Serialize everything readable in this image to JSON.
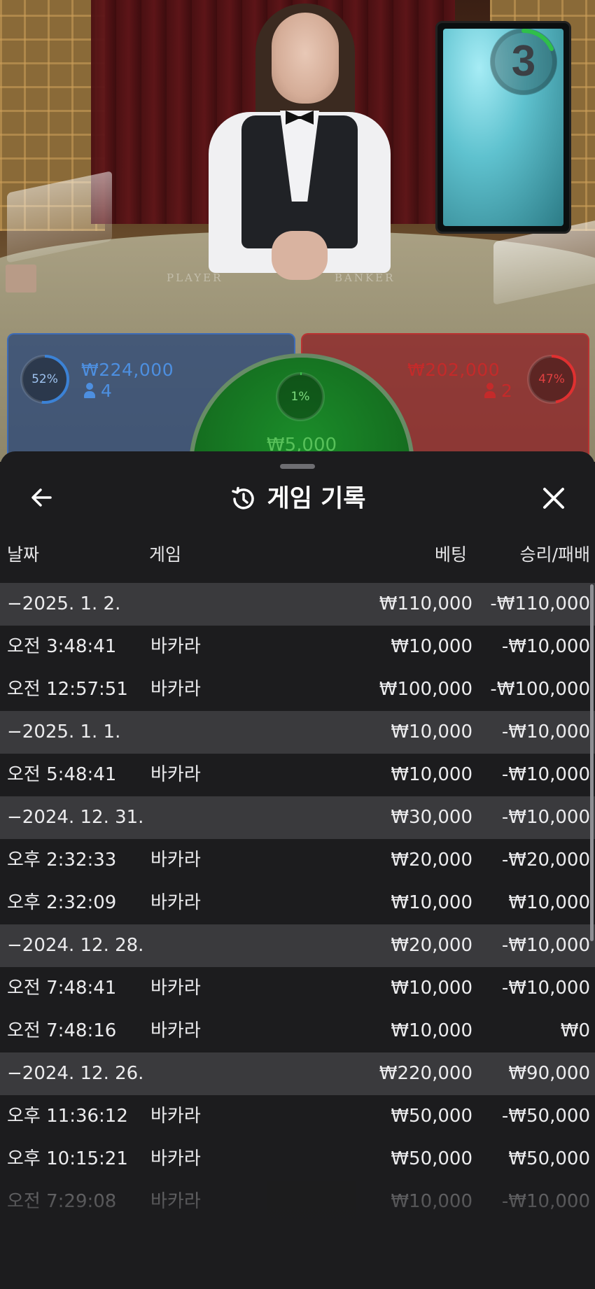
{
  "scene": {
    "table_labels": [
      "PLAYER",
      "BANKER"
    ],
    "countdown": "3"
  },
  "bets": {
    "player": {
      "percent_label": "52%",
      "percent": 52,
      "amount": "₩224,000",
      "players": "4",
      "color": "#3b82d6"
    },
    "banker": {
      "percent_label": "47%",
      "percent": 47,
      "amount": "₩202,000",
      "players": "2",
      "color": "#d63030"
    },
    "tie": {
      "percent_label": "1%",
      "percent": 1,
      "amount": "₩5,000",
      "color": "#3cc24a"
    }
  },
  "history": {
    "title": "게임 기록",
    "icons": {
      "back": "arrow-left-icon",
      "history": "history-clock-icon",
      "close": "close-icon"
    },
    "columns": {
      "date": "날짜",
      "game": "게임",
      "bet": "베팅",
      "result": "승리/패배"
    },
    "rows": [
      {
        "type": "group",
        "date": "−2025. 1. 2.",
        "game": "",
        "bet": "₩110,000",
        "result": "-₩110,000"
      },
      {
        "type": "item",
        "date": "오전 3:48:41",
        "game": "바카라",
        "bet": "₩10,000",
        "result": "-₩10,000"
      },
      {
        "type": "item",
        "date": "오전 12:57:51",
        "game": "바카라",
        "bet": "₩100,000",
        "result": "-₩100,000"
      },
      {
        "type": "group",
        "date": "−2025. 1. 1.",
        "game": "",
        "bet": "₩10,000",
        "result": "-₩10,000"
      },
      {
        "type": "item",
        "date": "오전 5:48:41",
        "game": "바카라",
        "bet": "₩10,000",
        "result": "-₩10,000"
      },
      {
        "type": "group",
        "date": "−2024. 12. 31.",
        "game": "",
        "bet": "₩30,000",
        "result": "-₩10,000"
      },
      {
        "type": "item",
        "date": "오후 2:32:33",
        "game": "바카라",
        "bet": "₩20,000",
        "result": "-₩20,000"
      },
      {
        "type": "item",
        "date": "오후 2:32:09",
        "game": "바카라",
        "bet": "₩10,000",
        "result": "₩10,000"
      },
      {
        "type": "group",
        "date": "−2024. 12. 28.",
        "game": "",
        "bet": "₩20,000",
        "result": "-₩10,000"
      },
      {
        "type": "item",
        "date": "오전 7:48:41",
        "game": "바카라",
        "bet": "₩10,000",
        "result": "-₩10,000"
      },
      {
        "type": "item",
        "date": "오전 7:48:16",
        "game": "바카라",
        "bet": "₩10,000",
        "result": "₩0"
      },
      {
        "type": "group",
        "date": "−2024. 12. 26.",
        "game": "",
        "bet": "₩220,000",
        "result": "₩90,000"
      },
      {
        "type": "item",
        "date": "오후 11:36:12",
        "game": "바카라",
        "bet": "₩50,000",
        "result": "-₩50,000"
      },
      {
        "type": "item",
        "date": "오후 10:15:21",
        "game": "바카라",
        "bet": "₩50,000",
        "result": "₩50,000"
      },
      {
        "type": "item",
        "date": "오전 7:29:08",
        "game": "바카라",
        "bet": "₩10,000",
        "result": "-₩10,000"
      }
    ]
  }
}
